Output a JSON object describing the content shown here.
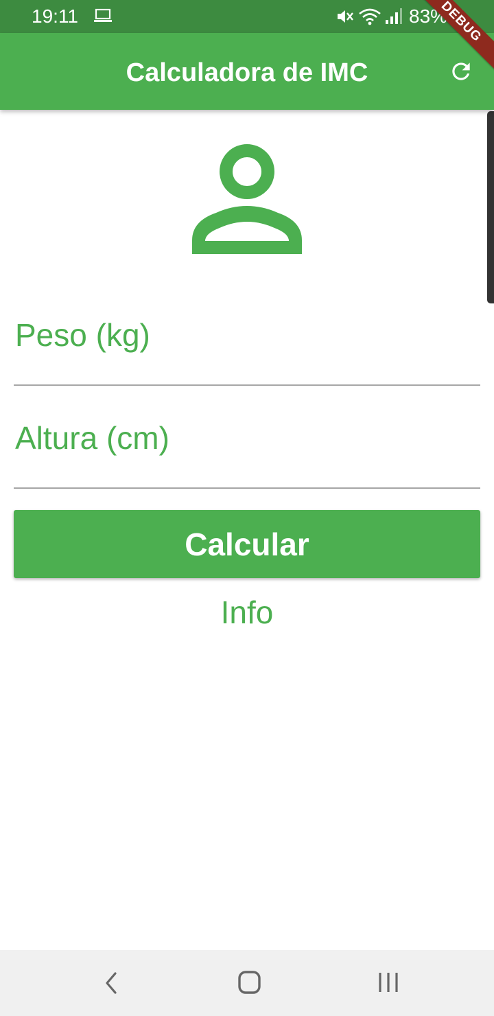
{
  "status_bar": {
    "time": "19:11",
    "battery": "83%",
    "icons": [
      "laptop-icon",
      "mute-icon",
      "wifi-icon",
      "signal-icon",
      "battery-icon"
    ]
  },
  "debug_banner": "DEBUG",
  "app_bar": {
    "title": "Calculadora de IMC",
    "action_icon": "refresh-icon"
  },
  "form": {
    "person_icon": "person-icon",
    "weight_label": "Peso (kg)",
    "height_label": "Altura (cm)",
    "calculate_label": "Calcular"
  },
  "info": "Info",
  "nav_bar": {
    "icons": [
      "back-icon",
      "home-icon",
      "recents-icon"
    ]
  },
  "colors": {
    "primary": "#4caf50",
    "status_bar": "#3d8b40",
    "debug_banner": "#8e2a1e",
    "field_underline": "#a6a6a6"
  }
}
